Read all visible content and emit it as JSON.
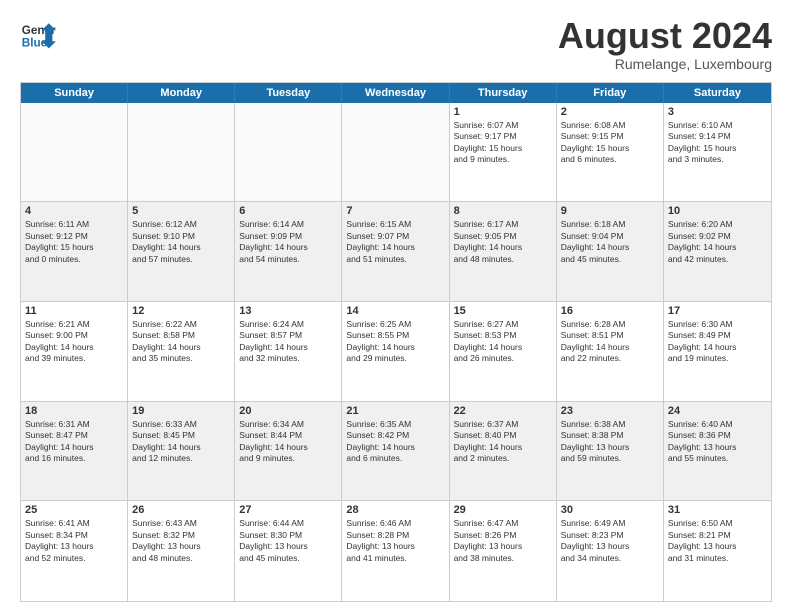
{
  "header": {
    "logo_line1": "General",
    "logo_line2": "Blue",
    "month": "August 2024",
    "location": "Rumelange, Luxembourg"
  },
  "days": [
    "Sunday",
    "Monday",
    "Tuesday",
    "Wednesday",
    "Thursday",
    "Friday",
    "Saturday"
  ],
  "weeks": [
    [
      {
        "day": "",
        "info": ""
      },
      {
        "day": "",
        "info": ""
      },
      {
        "day": "",
        "info": ""
      },
      {
        "day": "",
        "info": ""
      },
      {
        "day": "1",
        "info": "Sunrise: 6:07 AM\nSunset: 9:17 PM\nDaylight: 15 hours\nand 9 minutes."
      },
      {
        "day": "2",
        "info": "Sunrise: 6:08 AM\nSunset: 9:15 PM\nDaylight: 15 hours\nand 6 minutes."
      },
      {
        "day": "3",
        "info": "Sunrise: 6:10 AM\nSunset: 9:14 PM\nDaylight: 15 hours\nand 3 minutes."
      }
    ],
    [
      {
        "day": "4",
        "info": "Sunrise: 6:11 AM\nSunset: 9:12 PM\nDaylight: 15 hours\nand 0 minutes."
      },
      {
        "day": "5",
        "info": "Sunrise: 6:12 AM\nSunset: 9:10 PM\nDaylight: 14 hours\nand 57 minutes."
      },
      {
        "day": "6",
        "info": "Sunrise: 6:14 AM\nSunset: 9:09 PM\nDaylight: 14 hours\nand 54 minutes."
      },
      {
        "day": "7",
        "info": "Sunrise: 6:15 AM\nSunset: 9:07 PM\nDaylight: 14 hours\nand 51 minutes."
      },
      {
        "day": "8",
        "info": "Sunrise: 6:17 AM\nSunset: 9:05 PM\nDaylight: 14 hours\nand 48 minutes."
      },
      {
        "day": "9",
        "info": "Sunrise: 6:18 AM\nSunset: 9:04 PM\nDaylight: 14 hours\nand 45 minutes."
      },
      {
        "day": "10",
        "info": "Sunrise: 6:20 AM\nSunset: 9:02 PM\nDaylight: 14 hours\nand 42 minutes."
      }
    ],
    [
      {
        "day": "11",
        "info": "Sunrise: 6:21 AM\nSunset: 9:00 PM\nDaylight: 14 hours\nand 39 minutes."
      },
      {
        "day": "12",
        "info": "Sunrise: 6:22 AM\nSunset: 8:58 PM\nDaylight: 14 hours\nand 35 minutes."
      },
      {
        "day": "13",
        "info": "Sunrise: 6:24 AM\nSunset: 8:57 PM\nDaylight: 14 hours\nand 32 minutes."
      },
      {
        "day": "14",
        "info": "Sunrise: 6:25 AM\nSunset: 8:55 PM\nDaylight: 14 hours\nand 29 minutes."
      },
      {
        "day": "15",
        "info": "Sunrise: 6:27 AM\nSunset: 8:53 PM\nDaylight: 14 hours\nand 26 minutes."
      },
      {
        "day": "16",
        "info": "Sunrise: 6:28 AM\nSunset: 8:51 PM\nDaylight: 14 hours\nand 22 minutes."
      },
      {
        "day": "17",
        "info": "Sunrise: 6:30 AM\nSunset: 8:49 PM\nDaylight: 14 hours\nand 19 minutes."
      }
    ],
    [
      {
        "day": "18",
        "info": "Sunrise: 6:31 AM\nSunset: 8:47 PM\nDaylight: 14 hours\nand 16 minutes."
      },
      {
        "day": "19",
        "info": "Sunrise: 6:33 AM\nSunset: 8:45 PM\nDaylight: 14 hours\nand 12 minutes."
      },
      {
        "day": "20",
        "info": "Sunrise: 6:34 AM\nSunset: 8:44 PM\nDaylight: 14 hours\nand 9 minutes."
      },
      {
        "day": "21",
        "info": "Sunrise: 6:35 AM\nSunset: 8:42 PM\nDaylight: 14 hours\nand 6 minutes."
      },
      {
        "day": "22",
        "info": "Sunrise: 6:37 AM\nSunset: 8:40 PM\nDaylight: 14 hours\nand 2 minutes."
      },
      {
        "day": "23",
        "info": "Sunrise: 6:38 AM\nSunset: 8:38 PM\nDaylight: 13 hours\nand 59 minutes."
      },
      {
        "day": "24",
        "info": "Sunrise: 6:40 AM\nSunset: 8:36 PM\nDaylight: 13 hours\nand 55 minutes."
      }
    ],
    [
      {
        "day": "25",
        "info": "Sunrise: 6:41 AM\nSunset: 8:34 PM\nDaylight: 13 hours\nand 52 minutes."
      },
      {
        "day": "26",
        "info": "Sunrise: 6:43 AM\nSunset: 8:32 PM\nDaylight: 13 hours\nand 48 minutes."
      },
      {
        "day": "27",
        "info": "Sunrise: 6:44 AM\nSunset: 8:30 PM\nDaylight: 13 hours\nand 45 minutes."
      },
      {
        "day": "28",
        "info": "Sunrise: 6:46 AM\nSunset: 8:28 PM\nDaylight: 13 hours\nand 41 minutes."
      },
      {
        "day": "29",
        "info": "Sunrise: 6:47 AM\nSunset: 8:26 PM\nDaylight: 13 hours\nand 38 minutes."
      },
      {
        "day": "30",
        "info": "Sunrise: 6:49 AM\nSunset: 8:23 PM\nDaylight: 13 hours\nand 34 minutes."
      },
      {
        "day": "31",
        "info": "Sunrise: 6:50 AM\nSunset: 8:21 PM\nDaylight: 13 hours\nand 31 minutes."
      }
    ]
  ]
}
